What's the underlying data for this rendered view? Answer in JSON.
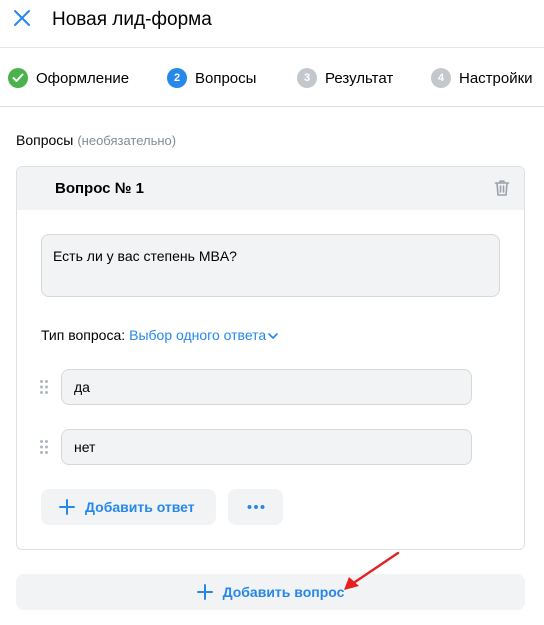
{
  "header": {
    "title": "Новая лид-форма",
    "close_icon": "close-icon"
  },
  "steps": [
    {
      "number": "",
      "label": "Оформление",
      "state": "done"
    },
    {
      "number": "2",
      "label": "Вопросы",
      "state": "active"
    },
    {
      "number": "3",
      "label": "Результат",
      "state": "todo"
    },
    {
      "number": "4",
      "label": "Настройки",
      "state": "todo"
    }
  ],
  "section": {
    "title": "Вопросы",
    "hint": "(необязательно)"
  },
  "question": {
    "title": "Вопрос № 1",
    "text": "Есть ли у вас степень MBA?",
    "type_label": "Тип вопроса:",
    "type_value": "Выбор одного ответа",
    "answers": [
      "да",
      "нет"
    ],
    "add_answer_label": "Добавить ответ",
    "more_label": "•••"
  },
  "add_question_label": "Добавить вопрос",
  "colors": {
    "accent": "#2688eb",
    "done": "#4bb34b",
    "annotation_arrow": "#e6201f"
  }
}
